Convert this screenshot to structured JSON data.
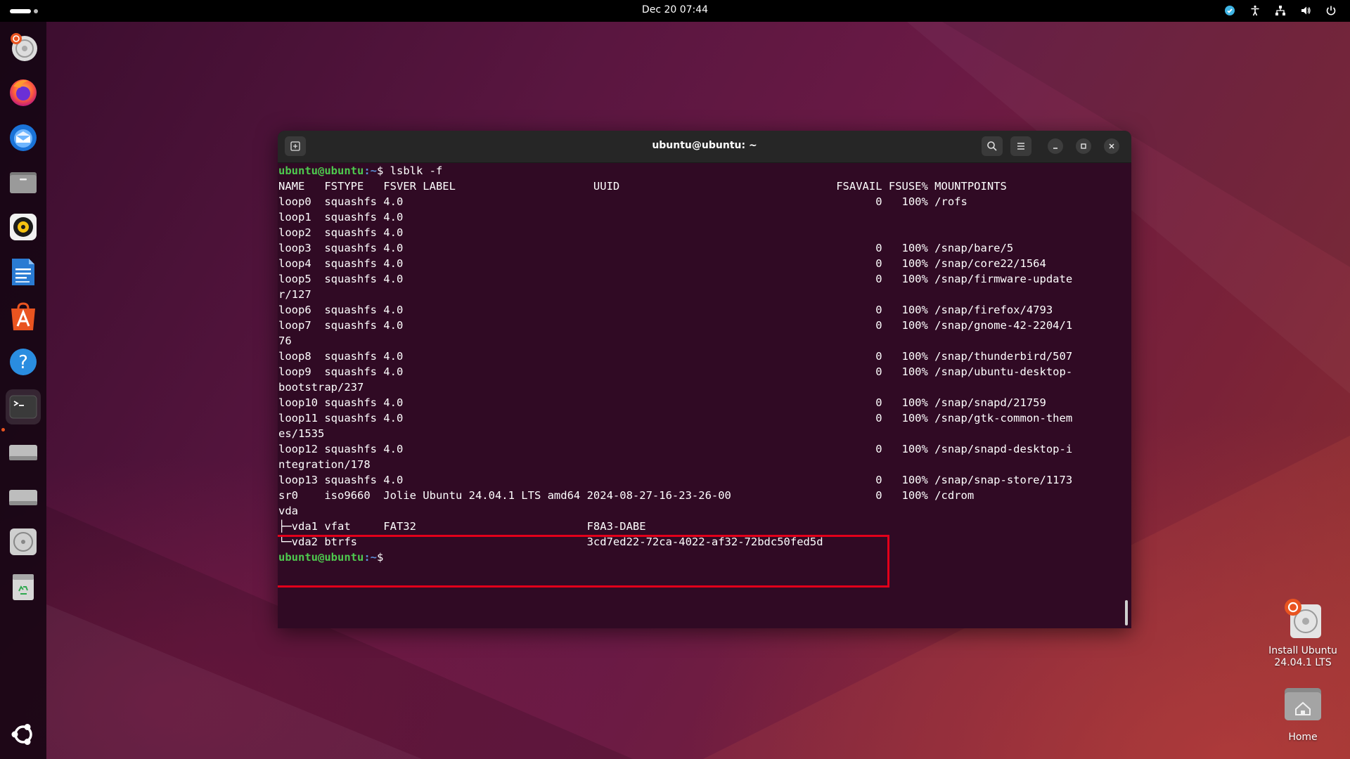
{
  "topbar": {
    "clock": "Dec 20  07:44",
    "tray_icons": [
      "update-icon",
      "accessibility-icon",
      "network-icon",
      "volume-icon",
      "power-icon"
    ]
  },
  "dock": {
    "items": [
      {
        "name": "install-ubuntu",
        "icon": "installer-icon"
      },
      {
        "name": "firefox",
        "icon": "firefox-icon"
      },
      {
        "name": "thunderbird",
        "icon": "thunderbird-icon"
      },
      {
        "name": "files",
        "icon": "files-icon"
      },
      {
        "name": "rhythmbox",
        "icon": "rhythmbox-icon"
      },
      {
        "name": "libreoffice-writer",
        "icon": "writer-icon"
      },
      {
        "name": "app-center",
        "icon": "app-center-icon"
      },
      {
        "name": "help",
        "icon": "help-icon"
      },
      {
        "name": "terminal",
        "icon": "terminal-icon"
      },
      {
        "name": "drive-1",
        "icon": "drive-icon"
      },
      {
        "name": "drive-2",
        "icon": "drive-icon"
      },
      {
        "name": "optical-drive",
        "icon": "disc-icon"
      },
      {
        "name": "trash",
        "icon": "trash-icon"
      }
    ],
    "show_apps_icon": "ubuntu-logo-icon"
  },
  "terminal": {
    "title": "ubuntu@ubuntu: ~",
    "prompt_user": "ubuntu@ubuntu",
    "prompt_path": ":~",
    "prompt_symbol": "$ ",
    "command": "lsblk -f",
    "output_lines": [
      "NAME   FSTYPE   FSVER LABEL                     UUID                                 FSAVAIL FSUSE% MOUNTPOINTS",
      "loop0  squashfs 4.0                                                                        0   100% /rofs",
      "loop1  squashfs 4.0",
      "loop2  squashfs 4.0",
      "loop3  squashfs 4.0                                                                        0   100% /snap/bare/5",
      "loop4  squashfs 4.0                                                                        0   100% /snap/core22/1564",
      "loop5  squashfs 4.0                                                                        0   100% /snap/firmware-update",
      "r/127",
      "loop6  squashfs 4.0                                                                        0   100% /snap/firefox/4793",
      "loop7  squashfs 4.0                                                                        0   100% /snap/gnome-42-2204/1",
      "76",
      "loop8  squashfs 4.0                                                                        0   100% /snap/thunderbird/507",
      "loop9  squashfs 4.0                                                                        0   100% /snap/ubuntu-desktop-",
      "bootstrap/237",
      "loop10 squashfs 4.0                                                                        0   100% /snap/snapd/21759",
      "loop11 squashfs 4.0                                                                        0   100% /snap/gtk-common-them",
      "es/1535",
      "loop12 squashfs 4.0                                                                        0   100% /snap/snapd-desktop-i",
      "ntegration/178",
      "loop13 squashfs 4.0                                                                        0   100% /snap/snap-store/1173",
      "sr0    iso9660  Jolie Ubuntu 24.04.1 LTS amd64 2024-08-27-16-23-26-00                      0   100% /cdrom",
      "vda",
      "├─vda1 vfat     FAT32                          F8A3-DABE",
      "└─vda2 btrfs                                   3cd7ed22-72ca-4022-af32-72bdc50fed5d"
    ]
  },
  "desktop": {
    "icons": [
      {
        "label_line1": "Install Ubuntu",
        "label_line2": "24.04.1 LTS",
        "icon": "installer-icon"
      },
      {
        "label_line1": "Home",
        "label_line2": "",
        "icon": "home-folder-icon"
      }
    ]
  },
  "colors": {
    "terminal_bg": "#300a24",
    "prompt_user": "#4ec94e",
    "prompt_path": "#5c8fd6",
    "highlight_border": "#e2001a",
    "accent": "#e95420"
  }
}
